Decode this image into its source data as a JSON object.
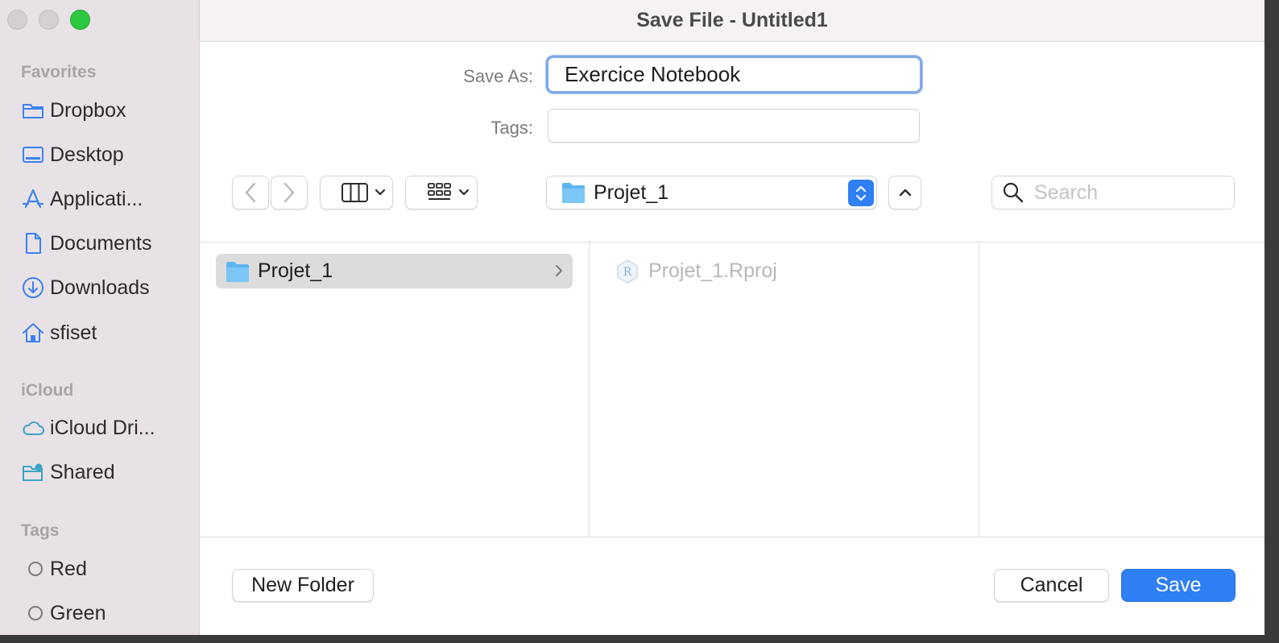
{
  "window": {
    "title": "Save File - Untitled1"
  },
  "sidebar": {
    "favorites_header": "Favorites",
    "favorites": [
      {
        "label": "Dropbox",
        "icon": "folder-icon"
      },
      {
        "label": "Desktop",
        "icon": "desktop-icon"
      },
      {
        "label": "Applicati...",
        "icon": "applications-icon"
      },
      {
        "label": "Documents",
        "icon": "document-icon"
      },
      {
        "label": "Downloads",
        "icon": "download-icon"
      },
      {
        "label": "sfiset",
        "icon": "home-icon"
      }
    ],
    "icloud_header": "iCloud",
    "icloud": [
      {
        "label": "iCloud Dri...",
        "icon": "cloud-icon"
      },
      {
        "label": "Shared",
        "icon": "shared-folder-icon"
      }
    ],
    "tags_header": "Tags",
    "tags": [
      {
        "label": "Red"
      },
      {
        "label": "Green"
      }
    ]
  },
  "form": {
    "save_as_label": "Save As:",
    "save_as_value": "Exercice Notebook",
    "tags_label": "Tags:",
    "tags_value": ""
  },
  "toolbar": {
    "location": "Projet_1",
    "search_placeholder": "Search"
  },
  "browser": {
    "column1": [
      {
        "label": "Projet_1",
        "selected": true
      }
    ],
    "column2": [
      {
        "label": "Projet_1.Rproj",
        "disabled": true
      }
    ]
  },
  "buttons": {
    "new_folder": "New Folder",
    "cancel": "Cancel",
    "save": "Save"
  },
  "colors": {
    "accent": "#2f7ff5",
    "sidebar_icon": "#3b82f0",
    "sidebar_bg": "#e8e2e6"
  }
}
